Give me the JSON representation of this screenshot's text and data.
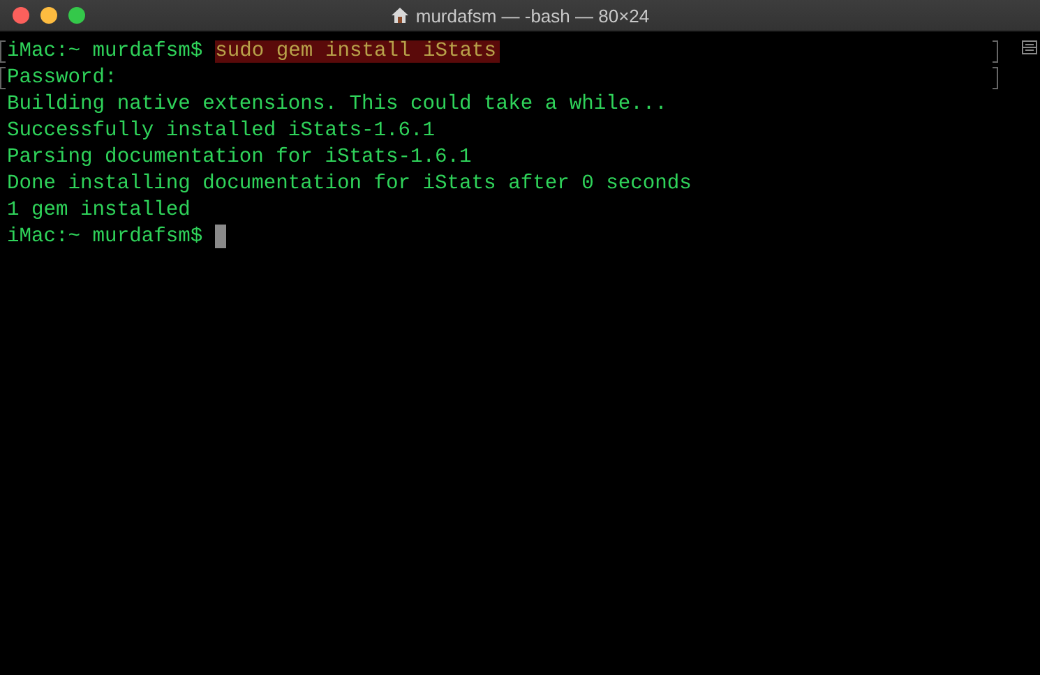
{
  "window": {
    "title": "murdafsm — -bash — 80×24"
  },
  "lines": [
    {
      "kind": "prompt",
      "prompt": "iMac:~ murdafsm$",
      "command": "sudo gem install iStats",
      "marked": true,
      "highlighted": true,
      "cursor": false
    },
    {
      "kind": "output",
      "text": "Password:",
      "marked": true
    },
    {
      "kind": "output",
      "text": "Building native extensions. This could take a while...",
      "marked": false
    },
    {
      "kind": "output",
      "text": "Successfully installed iStats-1.6.1",
      "marked": false
    },
    {
      "kind": "output",
      "text": "Parsing documentation for iStats-1.6.1",
      "marked": false
    },
    {
      "kind": "output",
      "text": "Done installing documentation for iStats after 0 seconds",
      "marked": false
    },
    {
      "kind": "output",
      "text": "1 gem installed",
      "marked": false
    },
    {
      "kind": "prompt",
      "prompt": "iMac:~ murdafsm$",
      "marked": false,
      "cursor": true
    }
  ]
}
